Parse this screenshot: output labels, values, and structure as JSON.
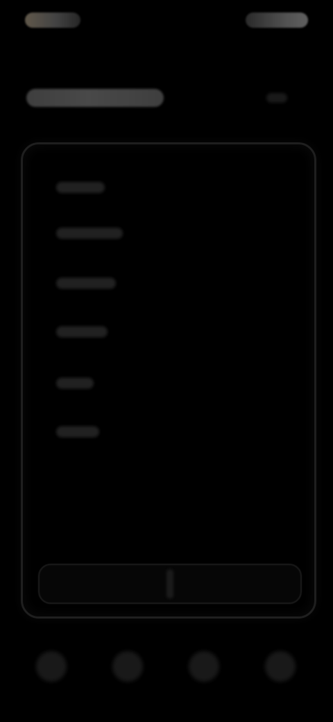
{
  "status_bar": {
    "time": "",
    "indicators": ""
  },
  "header": {
    "title": ""
  },
  "main": {
    "list_items": [
      {
        "label": ""
      },
      {
        "label": ""
      },
      {
        "label": ""
      },
      {
        "label": ""
      },
      {
        "label": ""
      },
      {
        "label": ""
      }
    ],
    "bottom_tray": {
      "left_label": "",
      "right_label": ""
    }
  },
  "bottom_nav": {
    "items": [
      {
        "icon": "nav-icon-1"
      },
      {
        "icon": "nav-icon-2"
      },
      {
        "icon": "nav-icon-3"
      },
      {
        "icon": "nav-icon-4"
      }
    ]
  },
  "colors": {
    "background": "#000000"
  }
}
